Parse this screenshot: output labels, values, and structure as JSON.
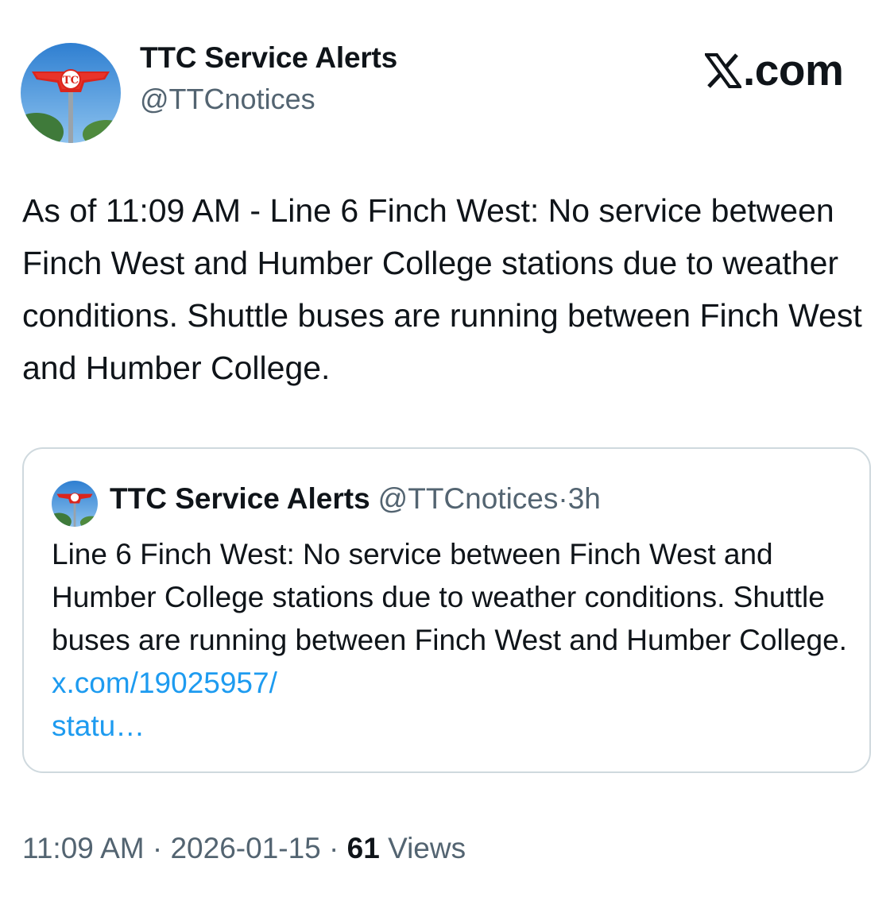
{
  "author": {
    "display_name": "TTC Service Alerts",
    "handle": "@TTCnotices"
  },
  "brand": {
    "label": ".com",
    "icon": "x-logo-icon"
  },
  "tweet": {
    "text": "As of 11:09 AM - Line 6 Finch West: No service between Finch West and Humber College stations due to weather conditions. Shuttle buses are running between Finch West and Humber College."
  },
  "quoted": {
    "display_name": "TTC Service Alerts",
    "handle": "@TTCnotices",
    "separator": "·",
    "time": "3h",
    "text": "Line 6 Finch West: No service between Finch West and Humber College stations due to weather conditions. Shuttle buses are running between Finch West and Humber College.",
    "link": "x.com/19025957/\nstatu…"
  },
  "meta": {
    "time": "11:09 AM",
    "separator": "·",
    "date": "2026-01-15",
    "views_count": "61",
    "views_label": "Views"
  },
  "colors": {
    "text": "#0f1419",
    "secondary": "#536471",
    "link": "#1d9bf0",
    "border": "#cfd9de",
    "ttc_red": "#da251d"
  }
}
